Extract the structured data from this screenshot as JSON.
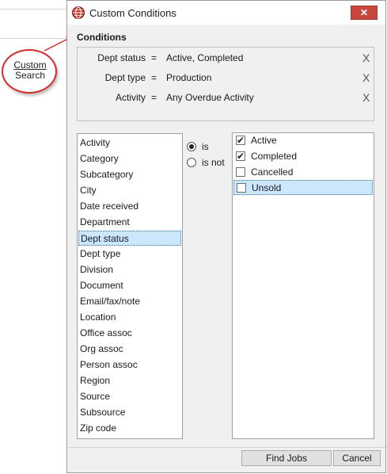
{
  "background": {
    "custom_search_line1": "Custom",
    "custom_search_line2": "Search"
  },
  "dialog": {
    "title": "Custom Conditions",
    "close_glyph": "✕",
    "conditions_label": "Conditions",
    "conditions": [
      {
        "field": "Dept status",
        "op": "=",
        "value": "Active, Completed",
        "remove": "X"
      },
      {
        "field": "Dept type",
        "op": "=",
        "value": "Production",
        "remove": "X"
      },
      {
        "field": "Activity",
        "op": "=",
        "value": "Any Overdue Activity",
        "remove": "X"
      }
    ],
    "fields": [
      "Activity",
      "Category",
      "Subcategory",
      "City",
      "Date received",
      "Department",
      "Dept status",
      "Dept type",
      "Division",
      "Document",
      "Email/fax/note",
      "Location",
      "Office assoc",
      "Org assoc",
      "Person assoc",
      "Region",
      "Source",
      "Subsource",
      "Zip code"
    ],
    "selected_field": "Dept status",
    "radio": {
      "is": "is",
      "is_not": "is not",
      "selected": "is"
    },
    "values": [
      {
        "label": "Active",
        "checked": true
      },
      {
        "label": "Completed",
        "checked": true
      },
      {
        "label": "Cancelled",
        "checked": false
      },
      {
        "label": "Unsold",
        "checked": false
      }
    ],
    "find_button": "Find Jobs",
    "cancel_button": "Cancel"
  },
  "colors": {
    "close_red": "#c9463d",
    "selection_blue": "#cce8ff",
    "annotation_red": "#d42b2b"
  }
}
